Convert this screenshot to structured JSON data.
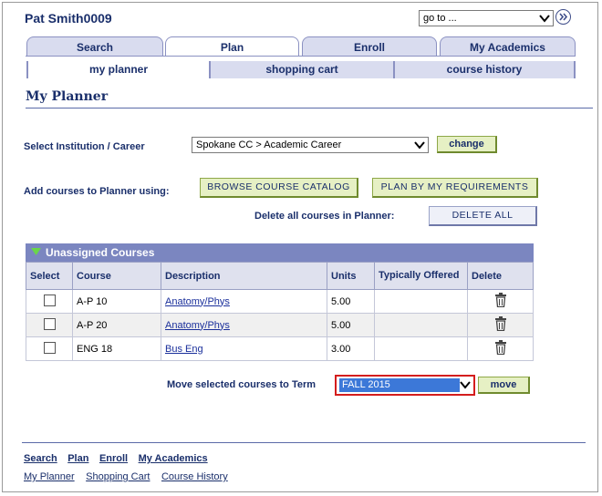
{
  "header": {
    "user_name": "Pat Smith0009",
    "goto_value": "go to ..."
  },
  "tabs": [
    {
      "label": "Search"
    },
    {
      "label": "Plan"
    },
    {
      "label": "Enroll"
    },
    {
      "label": "My Academics"
    }
  ],
  "subtabs": [
    {
      "label": "my planner"
    },
    {
      "label": "shopping cart"
    },
    {
      "label": "course history"
    }
  ],
  "page_title": "My Planner",
  "institution": {
    "label": "Select Institution / Career",
    "value": "Spokane CC > Academic Career",
    "change_label": "change"
  },
  "add_courses": {
    "label": "Add courses to Planner using:",
    "browse_label": "Browse Course Catalog",
    "requirements_label": "Plan By My Requirements",
    "delete_all_prompt": "Delete all courses in Planner:",
    "delete_all_label": "Delete All"
  },
  "grid": {
    "title": "Unassigned Courses",
    "columns": [
      "Select",
      "Course",
      "Description",
      "Units",
      "Typically Offered",
      "Delete"
    ],
    "rows": [
      {
        "course": "A-P 10",
        "description": "Anatomy/Phys",
        "units": "5.00",
        "typically_offered": ""
      },
      {
        "course": "A-P 20",
        "description": "Anatomy/Phys",
        "units": "5.00",
        "typically_offered": ""
      },
      {
        "course": "ENG 18",
        "description": "Bus Eng",
        "units": "3.00",
        "typically_offered": ""
      }
    ]
  },
  "move": {
    "label": "Move selected courses to Term",
    "term_value": "FALL 2015",
    "move_label": "move"
  },
  "footer": {
    "primary_links": [
      "Search",
      "Plan",
      "Enroll",
      "My Academics"
    ],
    "secondary_links": [
      "My Planner",
      "Shopping Cart",
      "Course History"
    ]
  },
  "colors": {
    "accent": "#1a2f6b",
    "highlight": "#d41d1d",
    "grid_header": "#7b86c0"
  }
}
